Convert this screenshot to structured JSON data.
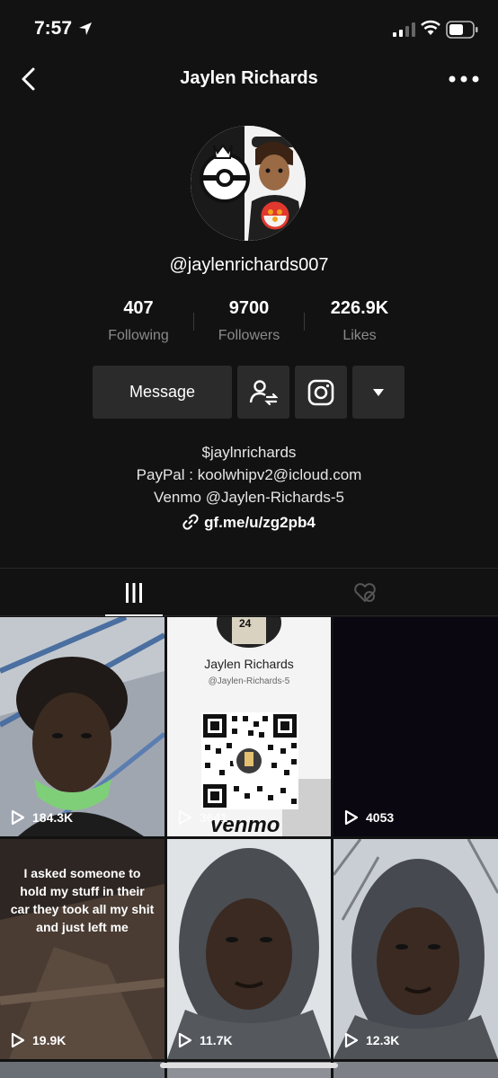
{
  "status_bar": {
    "time": "7:57"
  },
  "nav": {
    "title": "Jaylen Richards"
  },
  "profile": {
    "username": "@jaylenrichards007",
    "stats": [
      {
        "value": "407",
        "label": "Following"
      },
      {
        "value": "9700",
        "label": "Followers"
      },
      {
        "value": "226.9K",
        "label": "Likes"
      }
    ],
    "message_label": "Message",
    "bio": [
      "$jaylnrichards",
      "PayPal : koolwhipv2@icloud.com",
      "Venmo @Jaylen-Richards-5"
    ],
    "link": "gf.me/u/zg2pb4"
  },
  "tabs": [
    {
      "icon": "grid-icon",
      "active": true
    },
    {
      "icon": "liked-hidden-icon",
      "active": false
    }
  ],
  "videos": [
    {
      "views": "184.3K"
    },
    {
      "views": "3641",
      "card_name": "Jaylen Richards",
      "card_handle": "@Jaylen-Richards-5",
      "brand": "venmo",
      "jersey": "24"
    },
    {
      "views": "4053"
    },
    {
      "views": "19.9K",
      "overlay_text": "I asked someone to hold my stuff in their car they took all my shit and just left me"
    },
    {
      "views": "11.7K"
    },
    {
      "views": "12.3K"
    }
  ]
}
